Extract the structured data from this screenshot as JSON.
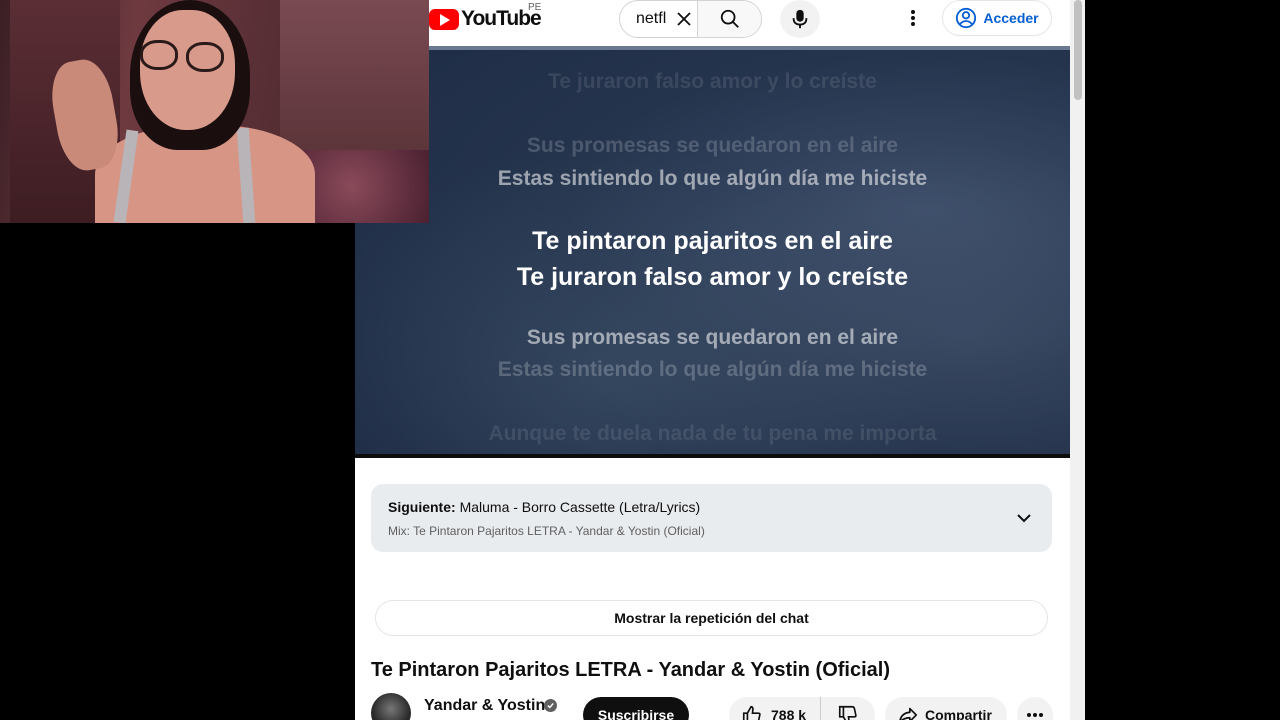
{
  "webcam": {
    "label": "Streamer webcam overlay"
  },
  "header": {
    "logo_text": "YouTube",
    "country_code": "PE",
    "search_value": "netfl",
    "signin_label": "Acceder"
  },
  "video": {
    "lyrics": {
      "faint_top": "Te juraron falso amor y lo creíste",
      "prev_faint": "Sus promesas se quedaron en el aire",
      "prev": "Estas sintiendo lo que algún día me hiciste",
      "current_line1": "Te pintaron pajaritos en el aire",
      "current_line2": "Te juraron falso amor y lo creíste",
      "next": "Sus promesas se quedaron en el aire",
      "next_faint": "Estas sintiendo lo que algún día me hiciste",
      "faint_bottom": "Aunque te duela nada de tu pena me importa"
    }
  },
  "up_next": {
    "prefix": "Siguiente:",
    "title": "Maluma - Borro Cassette (Letra/Lyrics)",
    "mix": "Mix: Te Pintaron Pajaritos LETRA - Yandar & Yostin (Oficial)"
  },
  "chat_replay_label": "Mostrar la repetición del chat",
  "video_title": "Te Pintaron Pajaritos LETRA - Yandar & Yostin (Oficial)",
  "channel": {
    "name": "Yandar & Yostin",
    "subscribe_label": "Suscribirse"
  },
  "actions": {
    "like_count": "788 k",
    "share_label": "Compartir"
  },
  "colors": {
    "brand_red": "#ff0000",
    "link_blue": "#065fd4"
  }
}
